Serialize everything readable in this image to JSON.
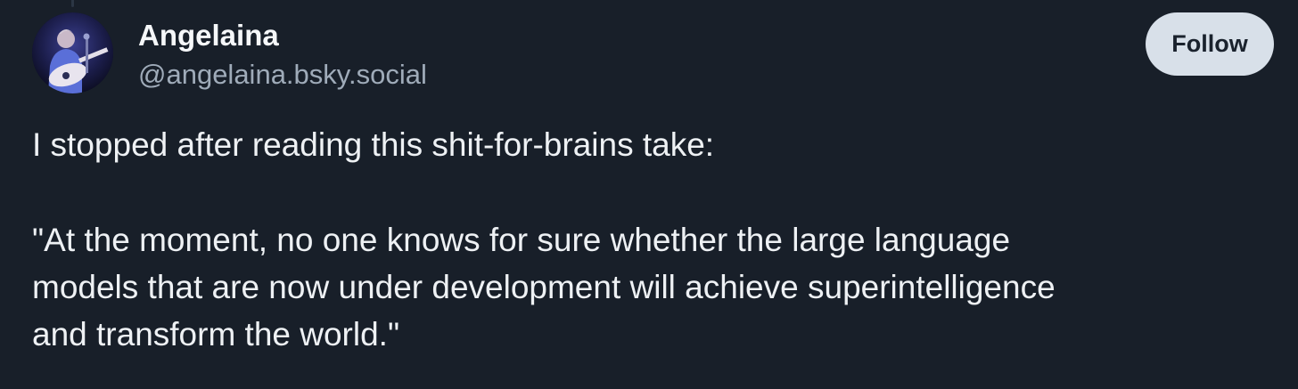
{
  "post": {
    "author": {
      "display_name": "Angelaina",
      "handle": "@angelaina.bsky.social"
    },
    "follow_label": "Follow",
    "text_lines": [
      "I stopped after reading this shit-for-brains take:",
      "\"At the moment, no one knows for sure whether the large language",
      "models that are now under development will achieve superintelligence",
      "and transform the world.\""
    ]
  },
  "colors": {
    "background": "#181f29",
    "follow_button_bg": "#d8e0e9",
    "handle_text": "#9fabb9",
    "body_text": "#eef1f4"
  },
  "icons": {
    "avatar": "avatar-photo"
  }
}
